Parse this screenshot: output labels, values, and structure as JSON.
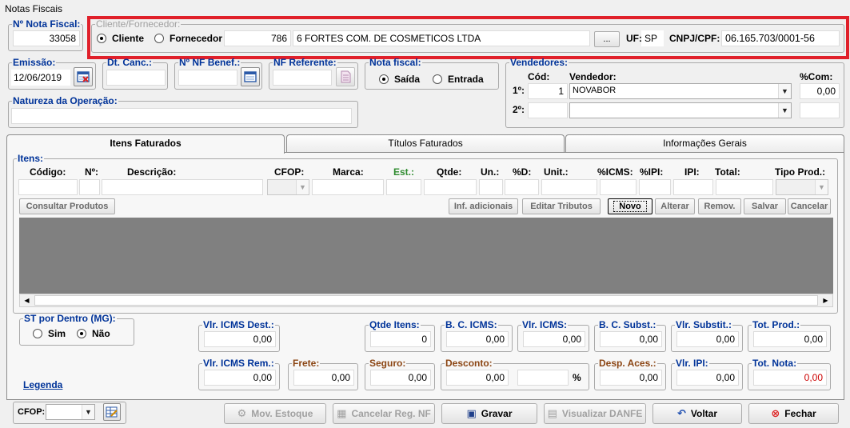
{
  "window": {
    "title": "Notas Fiscais"
  },
  "nota_fiscal": {
    "label": "Nº Nota Fiscal:",
    "value": "33058"
  },
  "cliente_fornecedor": {
    "legend": "Cliente/Fornecedor:",
    "option_cliente": "Cliente",
    "option_fornecedor": "Fornecedor",
    "code": "786",
    "name": "6 FORTES COM. DE COSMETICOS LTDA",
    "browse_label": "...",
    "uf_label": "UF:",
    "uf_value": "SP",
    "cnpj_label": "CNPJ/CPF:",
    "cnpj_value": "06.165.703/0001-56"
  },
  "emissao": {
    "label": "Emissão:",
    "value": "12/06/2019"
  },
  "dt_canc": {
    "label": "Dt. Canc.:",
    "value": ""
  },
  "nf_benef": {
    "label": "Nº NF Benef.:",
    "value": ""
  },
  "nf_referente": {
    "label": "NF Referente:",
    "value": ""
  },
  "nota_tipo": {
    "label": "Nota fiscal:",
    "option_saida": "Saída",
    "option_entrada": "Entrada"
  },
  "natureza": {
    "label": "Natureza da Operação:",
    "value": ""
  },
  "vendedores": {
    "legend": "Vendedores:",
    "col_cod": "Cód:",
    "col_vendedor": "Vendedor:",
    "col_com": "%Com:",
    "row1_label": "1º:",
    "row1_cod": "1",
    "row1_vendedor": "NOVABOR",
    "row1_com": "0,00",
    "row2_label": "2º:"
  },
  "tabs": {
    "itens": "Itens Faturados",
    "titulos": "Títulos Faturados",
    "info": "Informações Gerais"
  },
  "itens": {
    "legend": "Itens:",
    "headers": {
      "codigo": "Código:",
      "numero": "Nº:",
      "descricao": "Descrição:",
      "cfop": "CFOP:",
      "marca": "Marca:",
      "est": "Est.:",
      "qtde": "Qtde:",
      "un": "Un.:",
      "pd": "%D:",
      "unit": "Unit.:",
      "icms": "%ICMS:",
      "ipi_pct": "%IPI:",
      "ipi": "IPI:",
      "total": "Total:",
      "tipo_prod": "Tipo Prod.:"
    },
    "buttons": {
      "consultar": "Consultar Produtos",
      "inf_adicionais": "Inf. adicionais",
      "editar_tributos": "Editar Tributos",
      "novo": "Novo",
      "alterar": "Alterar",
      "remov": "Remov.",
      "salvar": "Salvar",
      "cancelar": "Cancelar"
    }
  },
  "st_dentro": {
    "legend": "ST por Dentro (MG):",
    "option_sim": "Sim",
    "option_nao": "Não"
  },
  "totais": {
    "icms_dest": {
      "label": "Vlr. ICMS Dest.:",
      "value": "0,00"
    },
    "qtde_itens": {
      "label": "Qtde Itens:",
      "value": "0"
    },
    "bc_icms": {
      "label": "B. C. ICMS:",
      "value": "0,00"
    },
    "vlr_icms": {
      "label": "Vlr. ICMS:",
      "value": "0,00"
    },
    "bc_subst": {
      "label": "B. C. Subst.:",
      "value": "0,00"
    },
    "vlr_subst": {
      "label": "Vlr. Substit.:",
      "value": "0,00"
    },
    "tot_prod": {
      "label": "Tot. Prod.:",
      "value": "0,00"
    },
    "icms_rem": {
      "label": "Vlr. ICMS Rem.:",
      "value": "0,00"
    },
    "frete": {
      "label": "Frete:",
      "value": "0,00"
    },
    "seguro": {
      "label": "Seguro:",
      "value": "0,00"
    },
    "desconto": {
      "label": "Desconto:",
      "value": "0,00",
      "pct_label": "%"
    },
    "desp_aces": {
      "label": "Desp. Aces.:",
      "value": "0,00"
    },
    "vlr_ipi": {
      "label": "Vlr. IPI:",
      "value": "0,00"
    },
    "tot_nota": {
      "label": "Tot. Nota:",
      "value": "0,00"
    }
  },
  "legenda": "Legenda",
  "footer": {
    "cfop_label": "CFOP:",
    "mov_estoque": "Mov. Estoque",
    "cancelar_reg": "Cancelar Reg. NF",
    "gravar": "Gravar",
    "visualizar_danfe": "Visualizar DANFE",
    "voltar": "Voltar",
    "fechar": "Fechar"
  },
  "colors": {
    "highlight": "#e0202a",
    "label_blue": "#003399",
    "grid_bg": "#808080"
  }
}
